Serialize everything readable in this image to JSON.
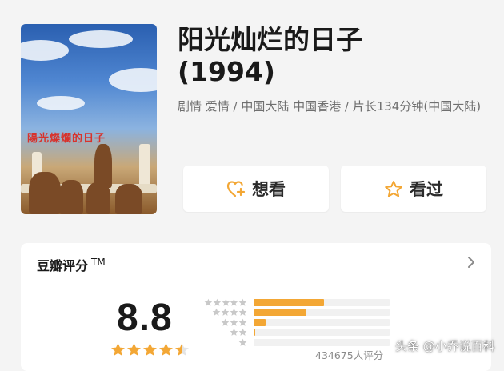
{
  "movie": {
    "title_line1": "阳光灿烂的日子",
    "title_line2": "(1994)",
    "meta": "剧情 爱情 / 中国大陆 中国香港 / 片长134分钟(中国大陆)"
  },
  "poster": {
    "title_art": "陽光燦爛的日子"
  },
  "actions": {
    "wish_label": "想看",
    "seen_label": "看过"
  },
  "rating": {
    "section_title": "豆瓣评分",
    "tm": "TM",
    "score": "8.8",
    "stars": 4.5,
    "count_text": "434675人评分",
    "distribution": [
      {
        "stars": 5,
        "fraction": 0.52
      },
      {
        "stars": 4,
        "fraction": 0.39
      },
      {
        "stars": 3,
        "fraction": 0.09
      },
      {
        "stars": 2,
        "fraction": 0.01
      },
      {
        "stars": 1,
        "fraction": 0.005
      }
    ]
  },
  "watermark": "头条 @小乔说百科",
  "colors": {
    "accent": "#f3a735",
    "background": "#f4f4f4",
    "meta_text": "#6f6f6f"
  },
  "icons": {
    "wish": "heart-plus-icon",
    "seen": "star-outline-icon",
    "chevron": "chevron-right-icon"
  }
}
